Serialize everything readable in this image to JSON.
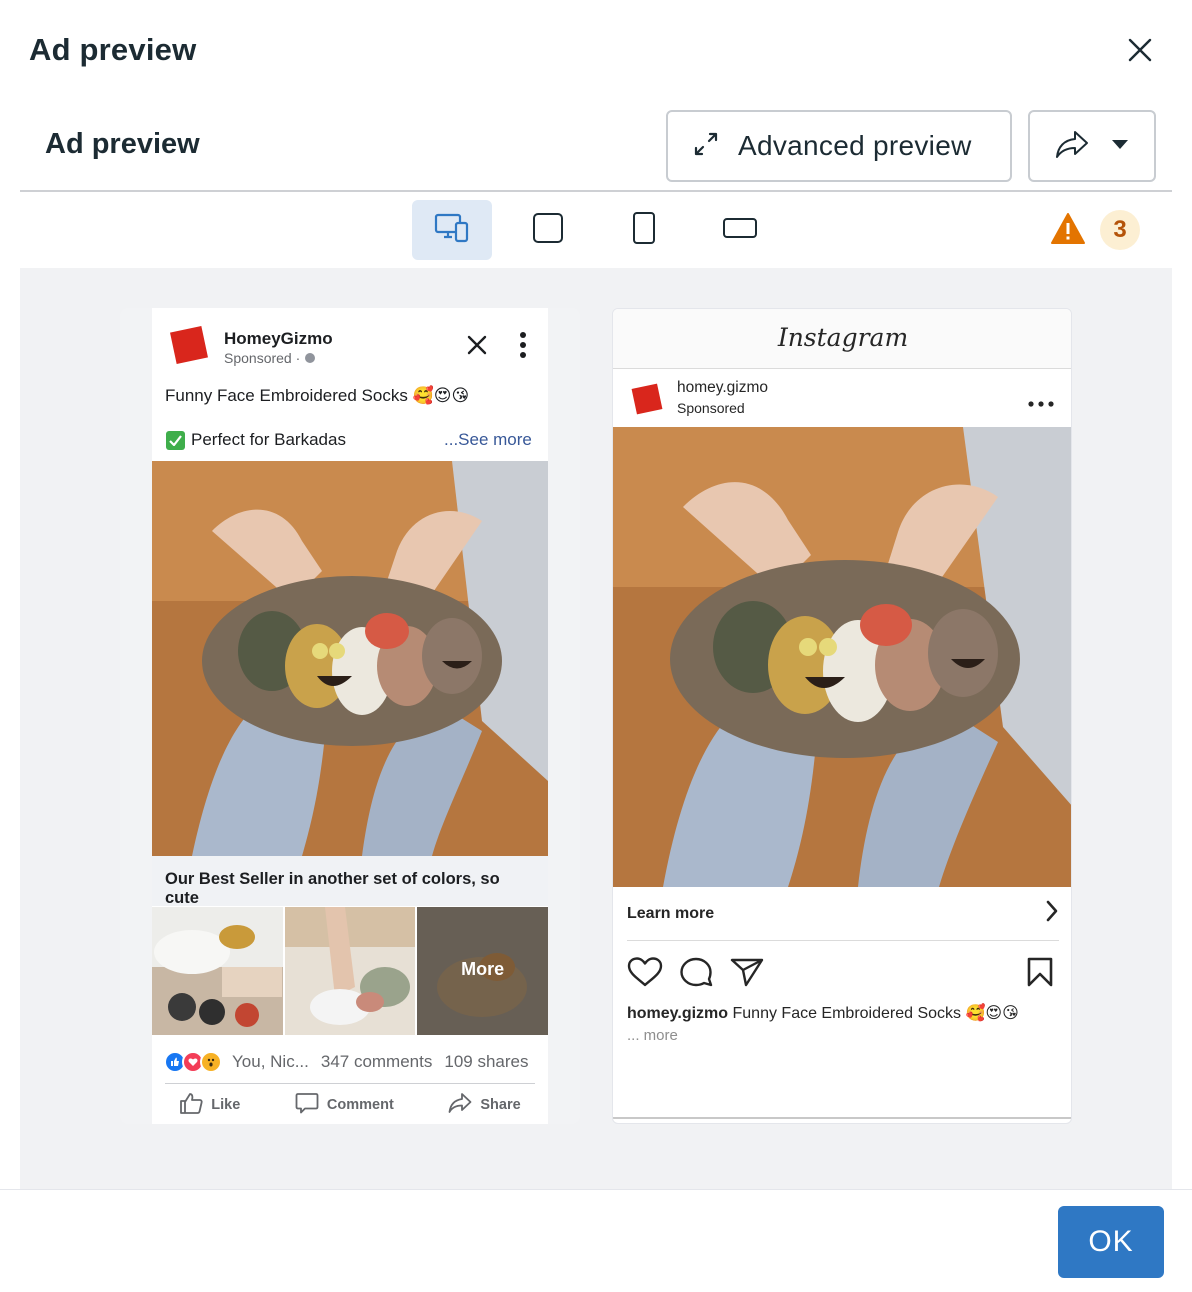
{
  "dialog": {
    "title": "Ad preview",
    "close_icon": "close-icon"
  },
  "section": {
    "title": "Ad preview",
    "advanced_preview_label": "Advanced preview",
    "expand_icon": "expand-arrows-icon",
    "share_icon": "share-arrow-icon",
    "dropdown_icon": "caret-down-icon"
  },
  "placements": [
    {
      "name": "multi-device",
      "icon": "devices-icon",
      "active": true
    },
    {
      "name": "square",
      "icon": "square-icon",
      "active": false
    },
    {
      "name": "vertical",
      "icon": "portrait-icon",
      "active": false
    },
    {
      "name": "horizontal",
      "icon": "landscape-icon",
      "active": false
    }
  ],
  "warnings": {
    "icon": "warning-triangle-icon",
    "count": "3",
    "color": "#e37400"
  },
  "facebook_preview": {
    "page_name": "HomeyGizmo",
    "sponsored": "Sponsored ·",
    "primary_text_line1": "Funny Face Embroidered Socks 🥰😍😘",
    "primary_text_line2": "Perfect for Barkadas",
    "see_more": "...See more",
    "headline": "Our Best Seller in another set of colors, so cute",
    "more_label": "More",
    "reactions_text": "You, Nic...",
    "comments": "347 comments",
    "shares": "109 shares",
    "actions": {
      "like": "Like",
      "comment": "Comment",
      "share": "Share"
    }
  },
  "instagram_preview": {
    "logo": "Instagram",
    "username": "homey.gizmo",
    "sponsored": "Sponsored",
    "cta": "Learn more",
    "caption_user": "homey.gizmo",
    "caption_text": "Funny Face Embroidered Socks 🥰😍😘",
    "more": "... more"
  },
  "footer": {
    "ok_label": "OK",
    "ok_color": "#2f78c4"
  },
  "colors": {
    "brand_red": "#d9261c",
    "link_blue": "#385898",
    "active_tab_bg": "#dfe9f5"
  }
}
